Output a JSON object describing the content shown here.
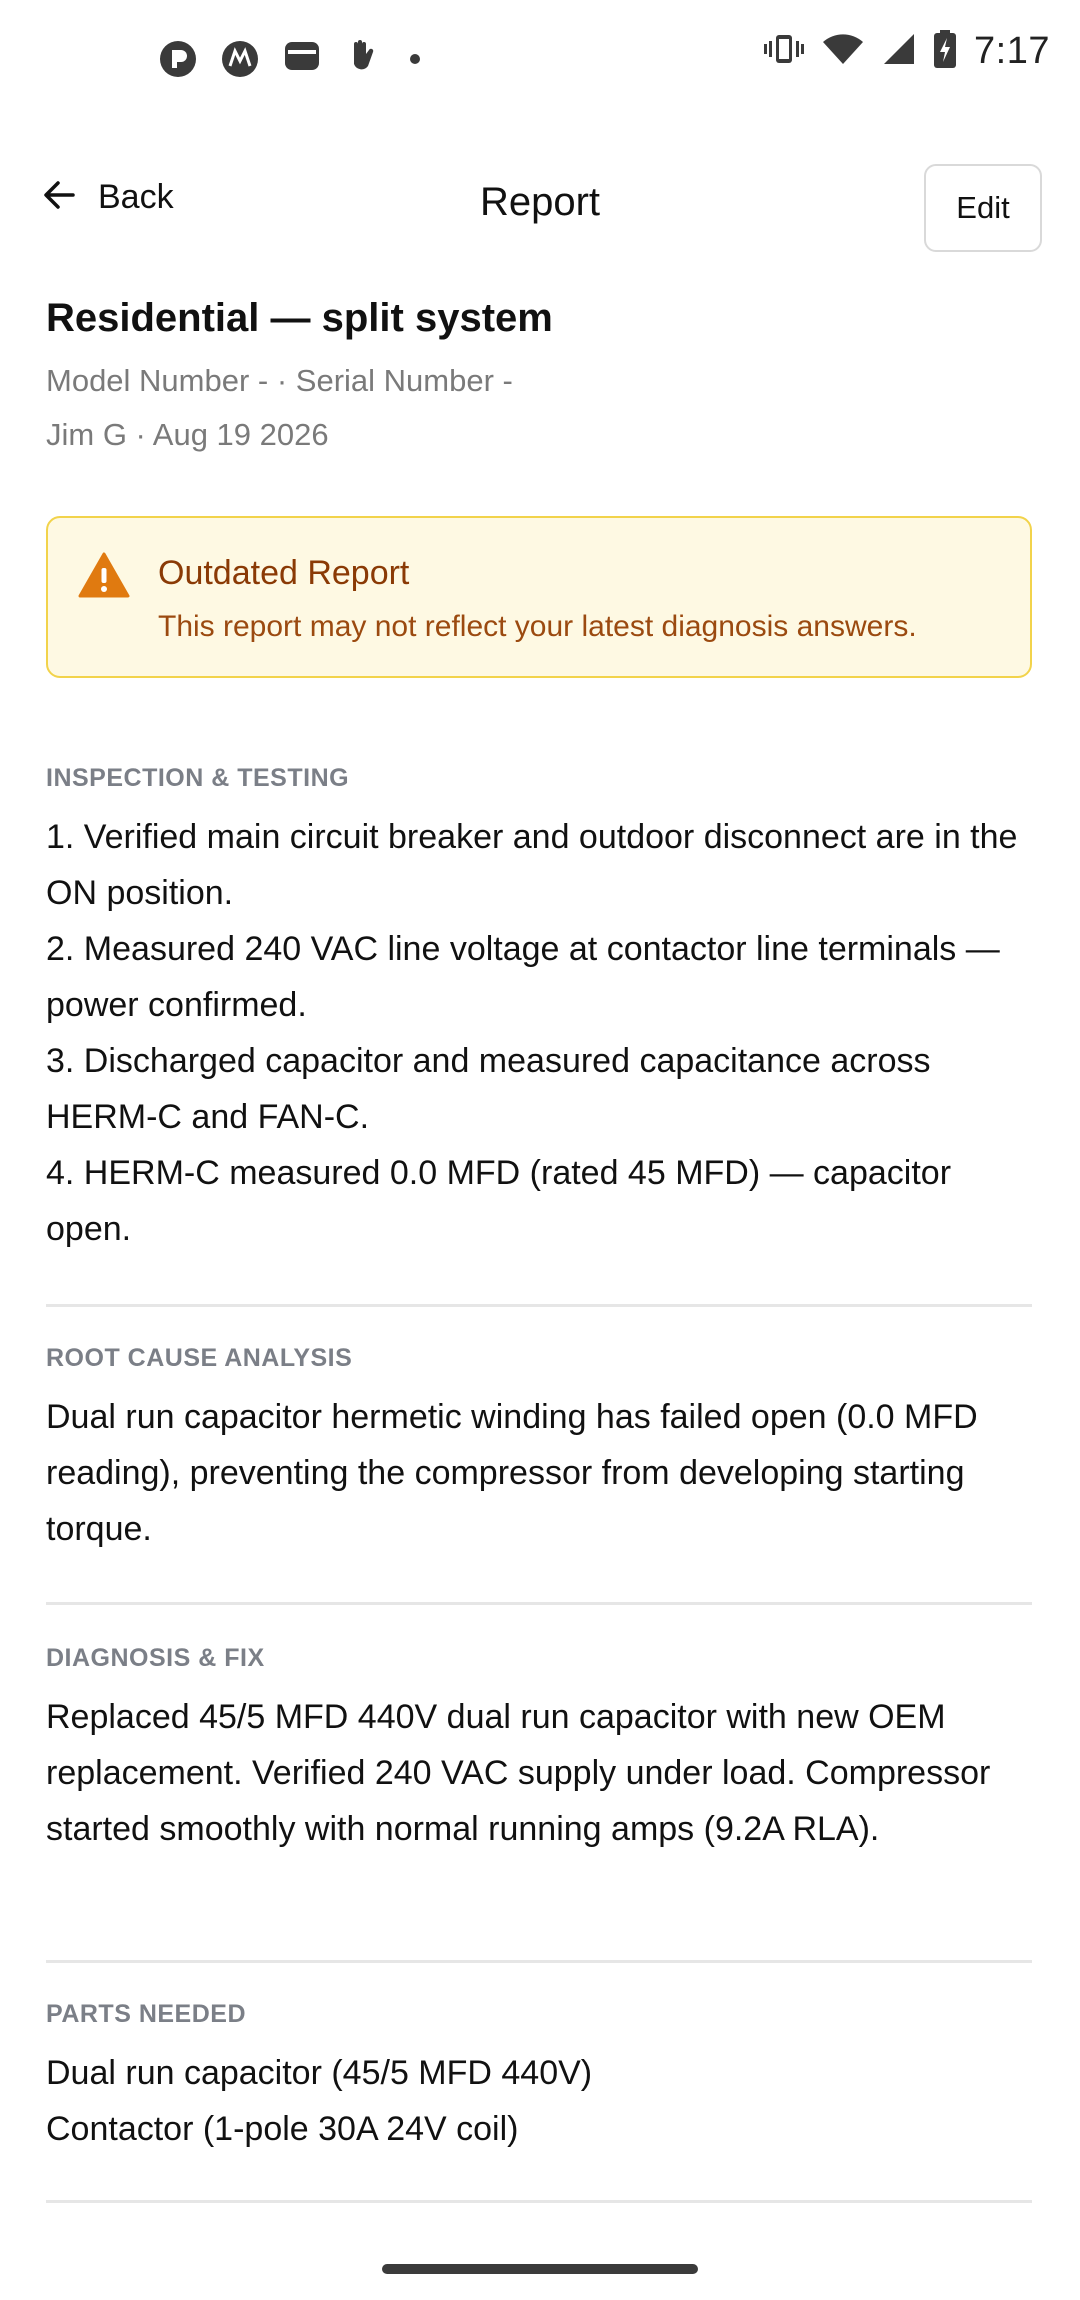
{
  "status_bar": {
    "time": "7:17",
    "left_icons": [
      "pocket-icon",
      "motorola-icon",
      "wallet-icon",
      "hand-icon",
      "dot-icon"
    ],
    "right_icons": [
      "vibrate-icon",
      "wifi-icon",
      "signal-icon",
      "battery-charging-icon"
    ]
  },
  "header": {
    "back_label": "Back",
    "title": "Report",
    "edit_label": "Edit"
  },
  "summary": {
    "title": "Residential — split system",
    "model_serial": "Model Number - · Serial Number -",
    "tech_date": "Jim G · Aug 19 2026"
  },
  "warning": {
    "title": "Outdated Report",
    "text": "This report may not reflect your latest diagnosis answers.",
    "color_border": "#f2d34b",
    "color_bg": "#fef9e3",
    "color_icon": "#e07a10"
  },
  "sections": [
    {
      "label": "INSPECTION & TESTING",
      "lines": [
        "1. Verified main circuit breaker and outdoor disconnect are in the ON position.",
        "2. Measured 240 VAC line voltage at contactor line terminals — power confirmed.",
        "3. Discharged capacitor and measured capacitance across HERM-C and FAN-C.",
        "4. HERM-C measured 0.0 MFD (rated 45 MFD) — capacitor open."
      ]
    },
    {
      "label": "ROOT CAUSE ANALYSIS",
      "lines": [
        "Dual run capacitor hermetic winding has failed open (0.0 MFD reading), preventing the compressor from developing starting torque."
      ]
    },
    {
      "label": "DIAGNOSIS & FIX",
      "lines": [
        "Replaced 45/5 MFD 440V dual run capacitor with new OEM replacement. Verified 240 VAC supply under load. Compressor started smoothly with normal running amps (9.2A RLA)."
      ]
    },
    {
      "label": "PARTS NEEDED",
      "lines": [
        "Dual run capacitor (45/5 MFD 440V)",
        "Contactor (1-pole 30A 24V coil)"
      ]
    }
  ]
}
